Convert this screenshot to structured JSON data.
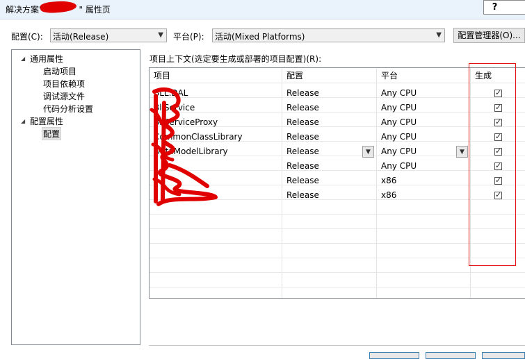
{
  "window": {
    "title_prefix": "解决方案\"",
    "title_suffix": "\" 属性页",
    "help_label": "?"
  },
  "toolbar": {
    "config_label": "配置(C):",
    "config_value": "活动(Release)",
    "platform_label": "平台(P):",
    "platform_value": "活动(Mixed Platforms)",
    "config_manager_label": "配置管理器(O)..."
  },
  "tree": {
    "common": "通用属性",
    "common_children": [
      "启动项目",
      "项目依赖项",
      "调试源文件",
      "代码分析设置"
    ],
    "config_props": "配置属性",
    "config_children": [
      "配置"
    ]
  },
  "grid": {
    "context_label": "项目上下文(选定要生成或部署的项目配置)(R):",
    "headers": [
      "项目",
      "配置",
      "平台",
      "生成"
    ],
    "rows": [
      {
        "project": "BLL.DAL",
        "config": "Release",
        "platform": "Any CPU",
        "build": true
      },
      {
        "project": "BllService",
        "config": "Release",
        "platform": "Any CPU",
        "build": true
      },
      {
        "project": "BllServiceProxy",
        "config": "Release",
        "platform": "Any CPU",
        "build": true
      },
      {
        "project": "CommonClassLibrary",
        "config": "Release",
        "platform": "Any CPU",
        "build": true
      },
      {
        "project": "DataModelLibrary",
        "config": "Release",
        "platform": "Any CPU",
        "build": true
      },
      {
        "project": "",
        "config": "Release",
        "platform": "Any CPU",
        "build": true
      },
      {
        "project": "",
        "config": "Release",
        "platform": "x86",
        "build": true
      },
      {
        "project": "",
        "config": "Release",
        "platform": "x86",
        "build": true
      }
    ]
  },
  "colors": {
    "annotation": "#e01010",
    "titlebar": "#eaf2fb"
  }
}
